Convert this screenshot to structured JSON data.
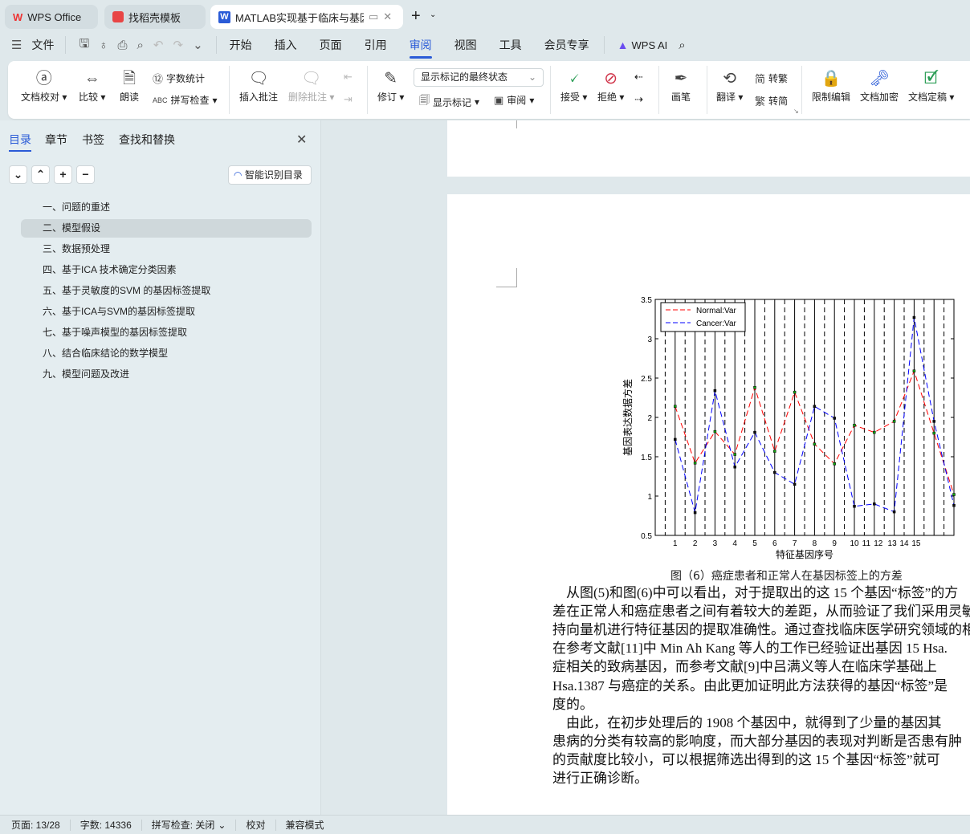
{
  "tabs": [
    {
      "label": "WPS Office",
      "icon": "wps-logo-icon"
    },
    {
      "label": "找稻壳模板",
      "icon": "docer-icon"
    },
    {
      "label": "MATLAB实现基于临床与基因",
      "icon": "word-doc-icon",
      "active": true
    }
  ],
  "menu": {
    "file": "文件",
    "items": [
      "开始",
      "插入",
      "页面",
      "引用",
      "审阅",
      "视图",
      "工具",
      "会员专享"
    ],
    "active": "审阅",
    "ai": "WPS AI"
  },
  "ribbon": {
    "proofread": "文档校对",
    "compare": "比较",
    "read_aloud": "朗读",
    "word_count": "字数统计",
    "spell_check": "拼写检查",
    "insert_comment": "插入批注",
    "delete_comment": "删除批注",
    "track_changes": "修订",
    "markup_select": "显示标记的最终状态",
    "show_markup": "显示标记",
    "review_pane": "审阅",
    "accept": "接受",
    "reject": "拒绝",
    "pen": "画笔",
    "translate": "翻译",
    "to_traditional": "转繁",
    "to_simplified": "转简",
    "restrict_edit": "限制编辑",
    "encrypt": "文档加密",
    "finalize": "文档定稿"
  },
  "sidebar": {
    "tabs": [
      "目录",
      "章节",
      "书签",
      "查找和替换"
    ],
    "active_tab": "目录",
    "smart_toc": "智能识别目录",
    "toc": [
      "一、问题的重述",
      "二、模型假设",
      "三、数据预处理",
      "四、基于ICA 技术确定分类因素",
      "五、基于灵敏度的SVM 的基因标签提取",
      "六、基于ICA与SVM的基因标签提取",
      "七、基于噪声模型的基因标签提取",
      "八、结合临床结论的数学模型",
      "九、模型问题及改进"
    ],
    "selected": 1
  },
  "document": {
    "caption": "图（6）癌症患者和正常人在基因标签上的方差",
    "lines": [
      "    从图(5)和图(6)中可以看出，对于提取出的这 15 个基因“标签”的方",
      "差在正常人和癌症患者之间有着较大的差距，从而验证了我们采用灵敏度",
      "持向量机进行特征基因的提取准确性。通过查找临床医学研究领域的相关",
      "在参考文献[11]中 Min Ah Kang 等人的工作已经验证出基因 15 Hsa.",
      "症相关的致病基因，而参考文献[9]中吕满义等人在临床学基础上",
      "Hsa.1387 与癌症的关系。由此更加证明此方法获得的基因“标签”是",
      "度的。",
      "    由此，在初步处理后的 1908 个基因中，就得到了少量的基因其",
      "患病的分类有较高的影响度，而大部分基因的表现对判断是否患有肿",
      "的贡献度比较小，可以根据筛选出得到的这 15 个基因“标签”就可",
      "进行正确诊断。"
    ]
  },
  "chart_data": {
    "type": "line",
    "xlabel": "特征基因序号",
    "ylabel": "基因表达数据方差",
    "x": [
      1,
      2,
      3,
      4,
      5,
      6,
      7,
      8,
      9,
      10,
      11,
      12,
      13,
      14,
      15
    ],
    "xlim": [
      0,
      15
    ],
    "ylim": [
      0.5,
      3.5
    ],
    "yticks": [
      0.5,
      1,
      1.5,
      2,
      2.5,
      3,
      3.5
    ],
    "xtick_labels": [
      "1",
      "2",
      "3",
      "4",
      "5",
      "6",
      "7",
      "8",
      "9",
      "10",
      "11",
      "12",
      "13",
      "14",
      "15"
    ],
    "xtick_label_positions": [
      1,
      2,
      3,
      4,
      5,
      6,
      7,
      8,
      9,
      10,
      10.6,
      11.2,
      11.9,
      12.5,
      13.1
    ],
    "grid": "solid vertical lines at integers, dashed at half-integers",
    "legend": "top-left",
    "series": [
      {
        "name": "Normal:Var",
        "color": "#ff0000",
        "values": [
          2.14,
          1.42,
          1.82,
          1.53,
          2.38,
          1.57,
          2.32,
          1.66,
          1.41,
          1.9,
          1.81,
          1.95,
          2.59,
          1.8,
          1.02
        ]
      },
      {
        "name": "Cancer:Var",
        "color": "#0000ff",
        "values": [
          1.72,
          0.79,
          2.34,
          1.37,
          1.81,
          1.3,
          1.15,
          2.14,
          1.99,
          0.87,
          0.9,
          0.8,
          3.27,
          1.95,
          0.88
        ]
      }
    ]
  },
  "status": {
    "page": "页面: 13/28",
    "words": "字数: 14336",
    "spell": "拼写检查: 关闭",
    "proof": "校对",
    "compat": "兼容模式"
  },
  "colors": {
    "accent": "#2a5bd7"
  }
}
